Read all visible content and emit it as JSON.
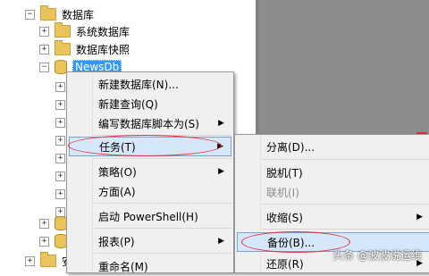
{
  "tree": {
    "items": [
      {
        "label": "数据库",
        "expander": "−"
      },
      {
        "label": "系统数据库",
        "expander": "+"
      },
      {
        "label": "数据库快照",
        "expander": "+"
      },
      {
        "label": "NewsDb",
        "expander": "−"
      },
      {
        "label": "安",
        "expander": "+"
      }
    ]
  },
  "context_menu": {
    "items": [
      {
        "label": "新建数据库(N)..."
      },
      {
        "label": "新建查询(Q)"
      },
      {
        "label": "编写数据库脚本为(S)",
        "submenu": "▶"
      },
      {
        "label": "任务(T)",
        "submenu": "▶"
      },
      {
        "label": "策略(O)",
        "submenu": "▶"
      },
      {
        "label": "方面(A)"
      },
      {
        "label": "启动 PowerShell(H)"
      },
      {
        "label": "报表(P)",
        "submenu": "▶"
      },
      {
        "label": "重命名(M)"
      }
    ]
  },
  "tasks_submenu": {
    "items": [
      {
        "label": "分离(D)..."
      },
      {
        "label": "脱机(T)"
      },
      {
        "label": "联机(I)"
      },
      {
        "label": "收缩(S)",
        "submenu": "▶"
      },
      {
        "label": "备份(B)..."
      },
      {
        "label": "还原(R)",
        "submenu": "▶"
      }
    ]
  },
  "watermark": "头条 @波波说运维",
  "colors": {
    "highlight": "#d5e7f8",
    "selection": "#3399ff",
    "annotation": "#e0313a"
  }
}
